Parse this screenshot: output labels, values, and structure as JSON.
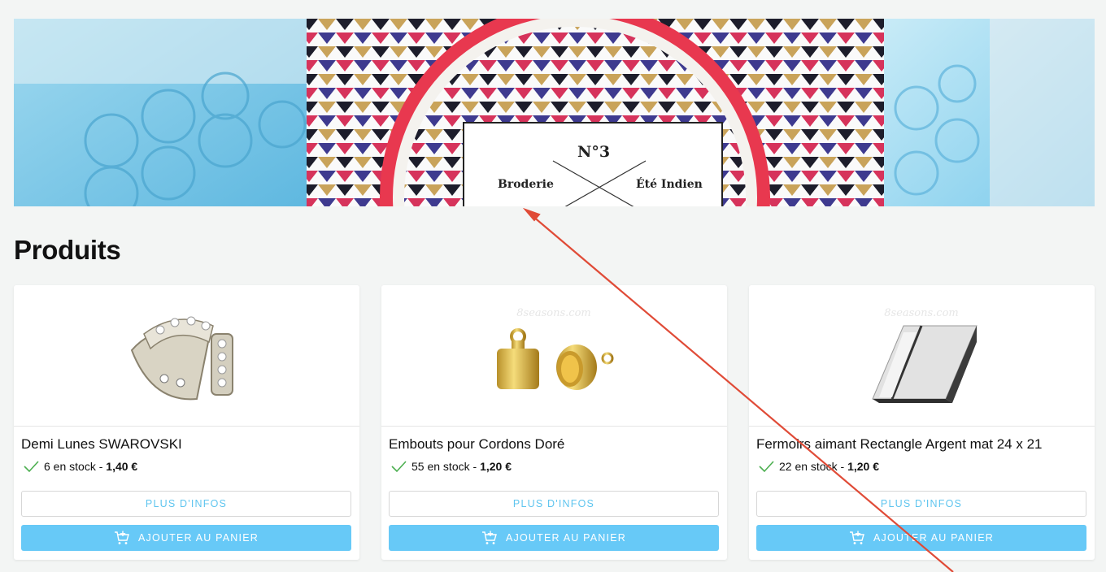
{
  "banner": {
    "label_number": "N°3",
    "label_left": "Broderie",
    "label_right": "Été Indien"
  },
  "section": {
    "title": "Produits"
  },
  "products": [
    {
      "name": "Demi Lunes SWAROVSKI",
      "stock": "6 en stock",
      "separator": " - ",
      "price": "1,40 €",
      "info_label": "PLUS D'INFOS",
      "cart_label": "AJOUTER AU PANIER",
      "watermark": ""
    },
    {
      "name": "Embouts pour Cordons Doré",
      "stock": "55 en stock",
      "separator": " - ",
      "price": "1,20 €",
      "info_label": "PLUS D'INFOS",
      "cart_label": "AJOUTER AU PANIER",
      "watermark": "8seasons.com"
    },
    {
      "name": "Fermoirs aimant Rectangle Argent mat 24 x 21",
      "stock": "22 en stock",
      "separator": " - ",
      "price": "1,20 €",
      "info_label": "PLUS D'INFOS",
      "cart_label": "AJOUTER AU PANIER",
      "watermark": "8seasons.com"
    }
  ],
  "colors": {
    "accent": "#67c9f7",
    "accent_text": "#5fc5ef",
    "stock_check": "#4caf50",
    "annotation_arrow": "#e04b37",
    "background": "#f3f5f4"
  },
  "icons": [
    "check-icon",
    "cart-plus-icon",
    "arrow-annotation"
  ]
}
